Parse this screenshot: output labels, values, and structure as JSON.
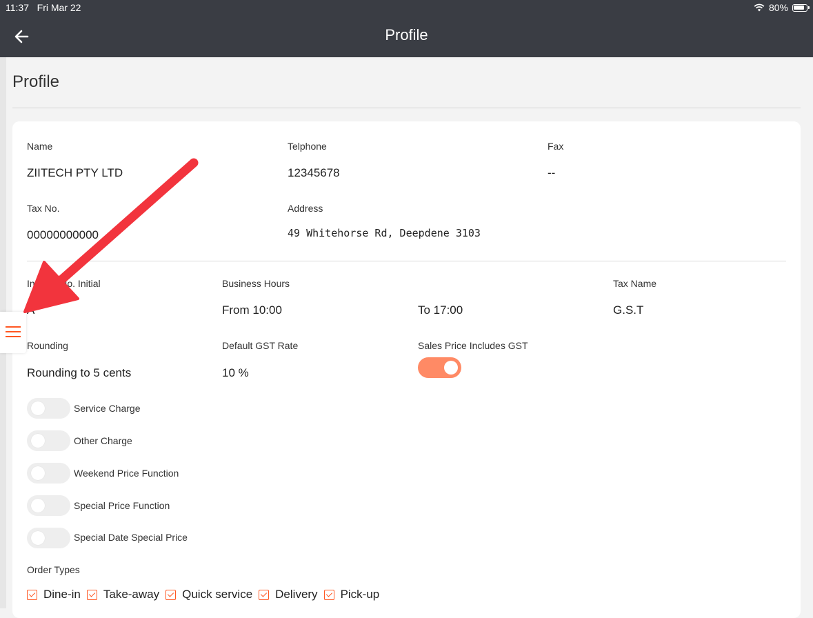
{
  "status_bar": {
    "time": "11:37",
    "date": "Fri Mar 22",
    "battery": "80%"
  },
  "topbar": {
    "title": "Profile"
  },
  "page_title": "Profile",
  "fields": {
    "name": {
      "label": "Name",
      "value": "ZIITECH PTY LTD"
    },
    "telephone": {
      "label": "Telphone",
      "value": "12345678"
    },
    "fax": {
      "label": "Fax",
      "value": "--"
    },
    "tax_no": {
      "label": "Tax No.",
      "value": "00000000000"
    },
    "address": {
      "label": "Address",
      "value": "49 Whitehorse Rd, Deepdene 3103"
    },
    "invoice_initial": {
      "label": "Invoice No. Initial",
      "value": "A"
    },
    "business_hours": {
      "label": "Business Hours",
      "from": "From 10:00",
      "to": "To 17:00"
    },
    "tax_name": {
      "label": "Tax Name",
      "value": "G.S.T"
    },
    "rounding": {
      "label": "Rounding",
      "value": "Rounding to 5 cents"
    },
    "gst_rate": {
      "label": "Default GST Rate",
      "value": "10 %"
    },
    "sales_price_gst": {
      "label": "Sales Price Includes GST",
      "on": true
    }
  },
  "switches": [
    {
      "label": "Service Charge",
      "on": false
    },
    {
      "label": "Other Charge",
      "on": false
    },
    {
      "label": "Weekend Price Function",
      "on": false
    },
    {
      "label": "Special Price Function",
      "on": false
    },
    {
      "label": "Special Date Special Price",
      "on": false
    }
  ],
  "order_types": {
    "label": "Order Types",
    "items": [
      {
        "label": "Dine-in",
        "checked": true
      },
      {
        "label": "Take-away",
        "checked": true
      },
      {
        "label": "Quick service",
        "checked": true
      },
      {
        "label": "Delivery",
        "checked": true
      },
      {
        "label": "Pick-up",
        "checked": true
      }
    ]
  },
  "colors": {
    "topbar": "#3a3d44",
    "accent": "#ff5722",
    "toggle_on": "#ff8a65",
    "annotation_arrow": "#f2343d"
  },
  "icons": [
    "back-arrow-icon",
    "wifi-icon",
    "battery-icon",
    "hamburger-menu-icon",
    "checkbox-checked-icon",
    "annotation-arrow"
  ]
}
